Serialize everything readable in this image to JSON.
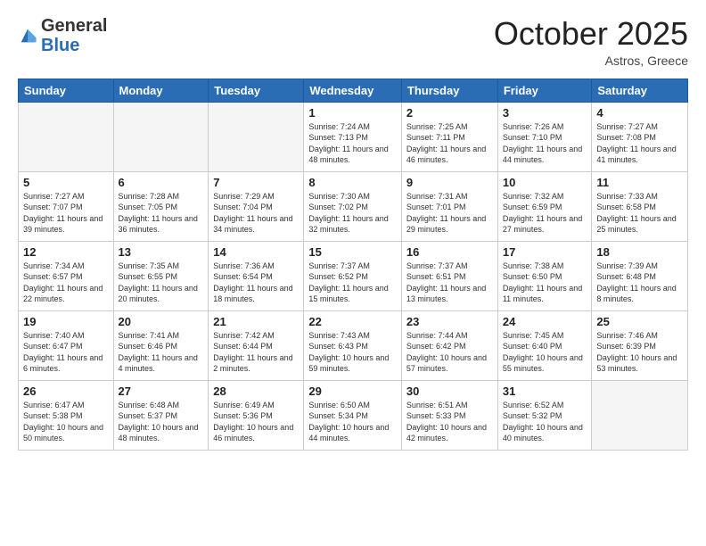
{
  "logo": {
    "general": "General",
    "blue": "Blue"
  },
  "header": {
    "month": "October 2025",
    "location": "Astros, Greece"
  },
  "weekdays": [
    "Sunday",
    "Monday",
    "Tuesday",
    "Wednesday",
    "Thursday",
    "Friday",
    "Saturday"
  ],
  "weeks": [
    [
      {
        "day": "",
        "sunrise": "",
        "sunset": "",
        "daylight": "",
        "empty": true
      },
      {
        "day": "",
        "sunrise": "",
        "sunset": "",
        "daylight": "",
        "empty": true
      },
      {
        "day": "",
        "sunrise": "",
        "sunset": "",
        "daylight": "",
        "empty": true
      },
      {
        "day": "1",
        "sunrise": "Sunrise: 7:24 AM",
        "sunset": "Sunset: 7:13 PM",
        "daylight": "Daylight: 11 hours and 48 minutes.",
        "empty": false
      },
      {
        "day": "2",
        "sunrise": "Sunrise: 7:25 AM",
        "sunset": "Sunset: 7:11 PM",
        "daylight": "Daylight: 11 hours and 46 minutes.",
        "empty": false
      },
      {
        "day": "3",
        "sunrise": "Sunrise: 7:26 AM",
        "sunset": "Sunset: 7:10 PM",
        "daylight": "Daylight: 11 hours and 44 minutes.",
        "empty": false
      },
      {
        "day": "4",
        "sunrise": "Sunrise: 7:27 AM",
        "sunset": "Sunset: 7:08 PM",
        "daylight": "Daylight: 11 hours and 41 minutes.",
        "empty": false
      }
    ],
    [
      {
        "day": "5",
        "sunrise": "Sunrise: 7:27 AM",
        "sunset": "Sunset: 7:07 PM",
        "daylight": "Daylight: 11 hours and 39 minutes.",
        "empty": false
      },
      {
        "day": "6",
        "sunrise": "Sunrise: 7:28 AM",
        "sunset": "Sunset: 7:05 PM",
        "daylight": "Daylight: 11 hours and 36 minutes.",
        "empty": false
      },
      {
        "day": "7",
        "sunrise": "Sunrise: 7:29 AM",
        "sunset": "Sunset: 7:04 PM",
        "daylight": "Daylight: 11 hours and 34 minutes.",
        "empty": false
      },
      {
        "day": "8",
        "sunrise": "Sunrise: 7:30 AM",
        "sunset": "Sunset: 7:02 PM",
        "daylight": "Daylight: 11 hours and 32 minutes.",
        "empty": false
      },
      {
        "day": "9",
        "sunrise": "Sunrise: 7:31 AM",
        "sunset": "Sunset: 7:01 PM",
        "daylight": "Daylight: 11 hours and 29 minutes.",
        "empty": false
      },
      {
        "day": "10",
        "sunrise": "Sunrise: 7:32 AM",
        "sunset": "Sunset: 6:59 PM",
        "daylight": "Daylight: 11 hours and 27 minutes.",
        "empty": false
      },
      {
        "day": "11",
        "sunrise": "Sunrise: 7:33 AM",
        "sunset": "Sunset: 6:58 PM",
        "daylight": "Daylight: 11 hours and 25 minutes.",
        "empty": false
      }
    ],
    [
      {
        "day": "12",
        "sunrise": "Sunrise: 7:34 AM",
        "sunset": "Sunset: 6:57 PM",
        "daylight": "Daylight: 11 hours and 22 minutes.",
        "empty": false
      },
      {
        "day": "13",
        "sunrise": "Sunrise: 7:35 AM",
        "sunset": "Sunset: 6:55 PM",
        "daylight": "Daylight: 11 hours and 20 minutes.",
        "empty": false
      },
      {
        "day": "14",
        "sunrise": "Sunrise: 7:36 AM",
        "sunset": "Sunset: 6:54 PM",
        "daylight": "Daylight: 11 hours and 18 minutes.",
        "empty": false
      },
      {
        "day": "15",
        "sunrise": "Sunrise: 7:37 AM",
        "sunset": "Sunset: 6:52 PM",
        "daylight": "Daylight: 11 hours and 15 minutes.",
        "empty": false
      },
      {
        "day": "16",
        "sunrise": "Sunrise: 7:37 AM",
        "sunset": "Sunset: 6:51 PM",
        "daylight": "Daylight: 11 hours and 13 minutes.",
        "empty": false
      },
      {
        "day": "17",
        "sunrise": "Sunrise: 7:38 AM",
        "sunset": "Sunset: 6:50 PM",
        "daylight": "Daylight: 11 hours and 11 minutes.",
        "empty": false
      },
      {
        "day": "18",
        "sunrise": "Sunrise: 7:39 AM",
        "sunset": "Sunset: 6:48 PM",
        "daylight": "Daylight: 11 hours and 8 minutes.",
        "empty": false
      }
    ],
    [
      {
        "day": "19",
        "sunrise": "Sunrise: 7:40 AM",
        "sunset": "Sunset: 6:47 PM",
        "daylight": "Daylight: 11 hours and 6 minutes.",
        "empty": false
      },
      {
        "day": "20",
        "sunrise": "Sunrise: 7:41 AM",
        "sunset": "Sunset: 6:46 PM",
        "daylight": "Daylight: 11 hours and 4 minutes.",
        "empty": false
      },
      {
        "day": "21",
        "sunrise": "Sunrise: 7:42 AM",
        "sunset": "Sunset: 6:44 PM",
        "daylight": "Daylight: 11 hours and 2 minutes.",
        "empty": false
      },
      {
        "day": "22",
        "sunrise": "Sunrise: 7:43 AM",
        "sunset": "Sunset: 6:43 PM",
        "daylight": "Daylight: 10 hours and 59 minutes.",
        "empty": false
      },
      {
        "day": "23",
        "sunrise": "Sunrise: 7:44 AM",
        "sunset": "Sunset: 6:42 PM",
        "daylight": "Daylight: 10 hours and 57 minutes.",
        "empty": false
      },
      {
        "day": "24",
        "sunrise": "Sunrise: 7:45 AM",
        "sunset": "Sunset: 6:40 PM",
        "daylight": "Daylight: 10 hours and 55 minutes.",
        "empty": false
      },
      {
        "day": "25",
        "sunrise": "Sunrise: 7:46 AM",
        "sunset": "Sunset: 6:39 PM",
        "daylight": "Daylight: 10 hours and 53 minutes.",
        "empty": false
      }
    ],
    [
      {
        "day": "26",
        "sunrise": "Sunrise: 6:47 AM",
        "sunset": "Sunset: 5:38 PM",
        "daylight": "Daylight: 10 hours and 50 minutes.",
        "empty": false
      },
      {
        "day": "27",
        "sunrise": "Sunrise: 6:48 AM",
        "sunset": "Sunset: 5:37 PM",
        "daylight": "Daylight: 10 hours and 48 minutes.",
        "empty": false
      },
      {
        "day": "28",
        "sunrise": "Sunrise: 6:49 AM",
        "sunset": "Sunset: 5:36 PM",
        "daylight": "Daylight: 10 hours and 46 minutes.",
        "empty": false
      },
      {
        "day": "29",
        "sunrise": "Sunrise: 6:50 AM",
        "sunset": "Sunset: 5:34 PM",
        "daylight": "Daylight: 10 hours and 44 minutes.",
        "empty": false
      },
      {
        "day": "30",
        "sunrise": "Sunrise: 6:51 AM",
        "sunset": "Sunset: 5:33 PM",
        "daylight": "Daylight: 10 hours and 42 minutes.",
        "empty": false
      },
      {
        "day": "31",
        "sunrise": "Sunrise: 6:52 AM",
        "sunset": "Sunset: 5:32 PM",
        "daylight": "Daylight: 10 hours and 40 minutes.",
        "empty": false
      },
      {
        "day": "",
        "sunrise": "",
        "sunset": "",
        "daylight": "",
        "empty": true
      }
    ]
  ]
}
